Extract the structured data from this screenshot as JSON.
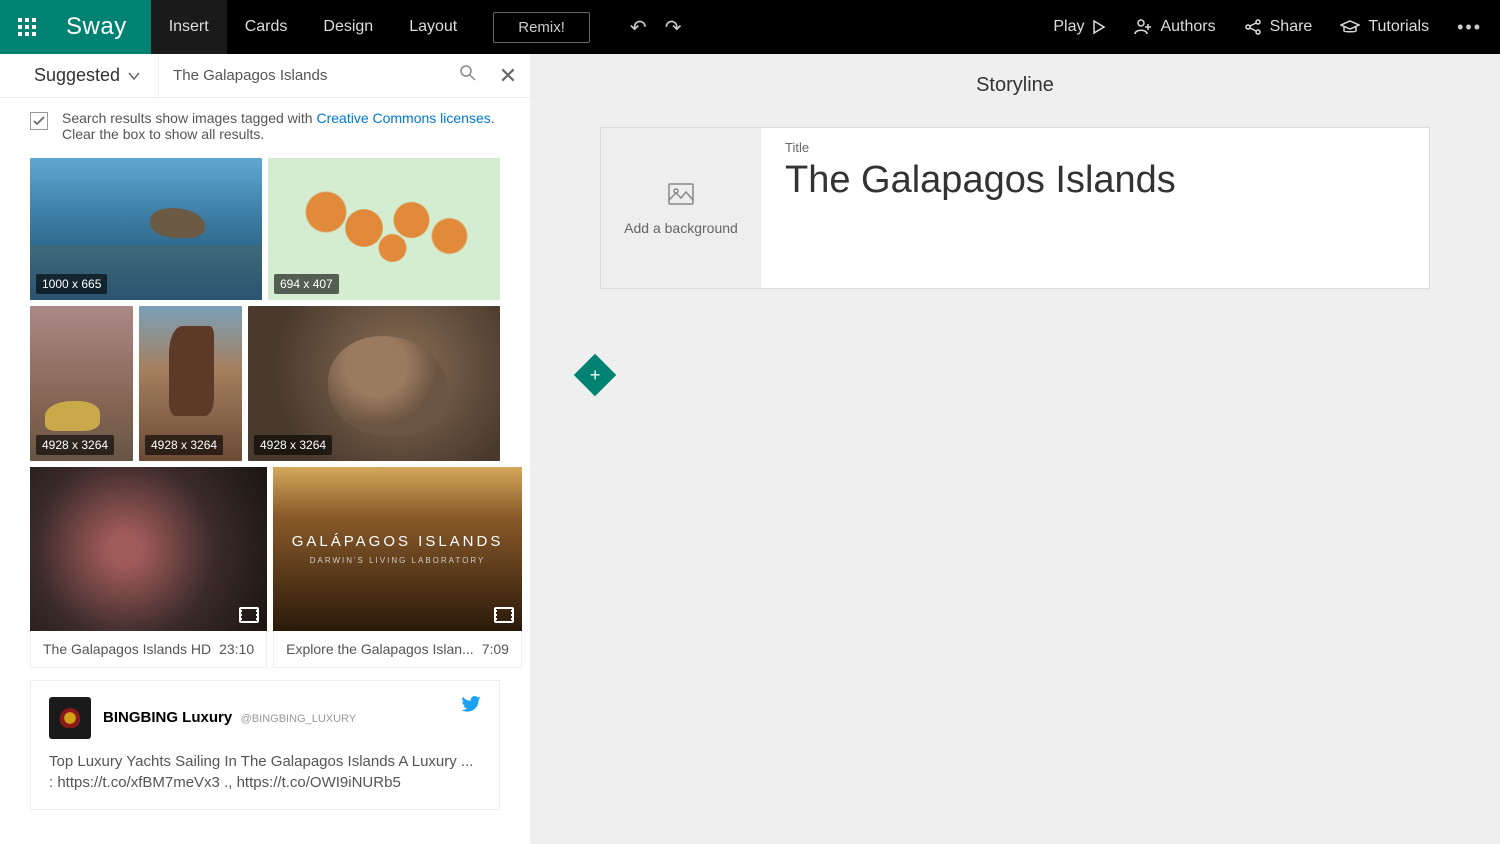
{
  "app": {
    "name": "Sway"
  },
  "topbar": {
    "tabs": {
      "insert": "Insert",
      "cards": "Cards",
      "design": "Design",
      "layout": "Layout"
    },
    "remix": "Remix!",
    "play": "Play",
    "authors": "Authors",
    "share": "Share",
    "tutorials": "Tutorials"
  },
  "left": {
    "suggested": "Suggested",
    "search_value": "The Galapagos Islands",
    "cc_text_1": "Search results show images tagged with ",
    "cc_link": "Creative Commons licenses",
    "cc_text_2": ".",
    "cc_text_3": "Clear the box to show all results.",
    "thumbs": {
      "t1": "1000 x 665",
      "t2": "694 x 407",
      "t3": "4928 x 3264",
      "t4": "4928 x 3264",
      "t5": "4928 x 3264"
    },
    "videos": {
      "v1": {
        "title": "The Galapagos Islands HD",
        "duration": "23:10"
      },
      "v2": {
        "title": "Explore the Galapagos Islan...",
        "duration": "7:09",
        "overlay1": "GALÁPAGOS ISLANDS",
        "overlay2": "DARWIN'S LIVING LABORATORY"
      }
    },
    "tweet": {
      "name": "BINGBING Luxury",
      "handle": "@BINGBING_LUXURY",
      "text": "Top Luxury Yachts Sailing In The Galapagos Islands A Luxury ... : https://t.co/xfBM7meVx3 ., https://t.co/OWI9iNURb5"
    }
  },
  "right": {
    "storyline": "Storyline",
    "add_background": "Add a background",
    "title_label": "Title",
    "title_value": "The Galapagos Islands"
  }
}
